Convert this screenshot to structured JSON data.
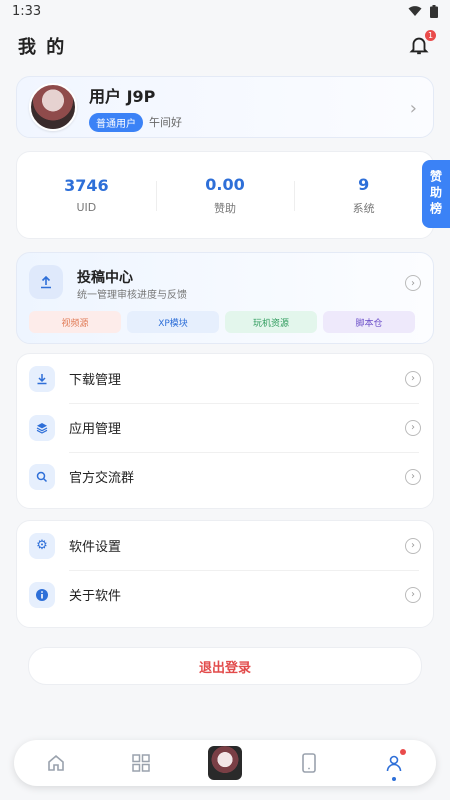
{
  "status": {
    "time": "1:33"
  },
  "header": {
    "title": "我 的",
    "notification_count": "1"
  },
  "profile": {
    "name": "用户 J9P",
    "tag": "普通用户",
    "greeting": "午间好"
  },
  "stats": [
    {
      "value": "3746",
      "label": "UID"
    },
    {
      "value": "0.00",
      "label": "赞助"
    },
    {
      "value": "9",
      "label": "系统"
    }
  ],
  "sponsor_label": "赞助榜",
  "submit": {
    "title": "投稿中心",
    "subtitle": "统一管理审核进度与反馈",
    "pills": [
      "视频源",
      "XP模块",
      "玩机资源",
      "脚本仓"
    ]
  },
  "menu1": [
    {
      "label": "下载管理",
      "icon": "download-icon"
    },
    {
      "label": "应用管理",
      "icon": "layers-icon"
    },
    {
      "label": "官方交流群",
      "icon": "search-icon"
    }
  ],
  "menu2": [
    {
      "label": "软件设置",
      "icon": "gear-icon"
    },
    {
      "label": "关于软件",
      "icon": "info-icon"
    }
  ],
  "logout_label": "退出登录",
  "colors": {
    "accent": "#3b82f6",
    "danger": "#e24b4b"
  }
}
